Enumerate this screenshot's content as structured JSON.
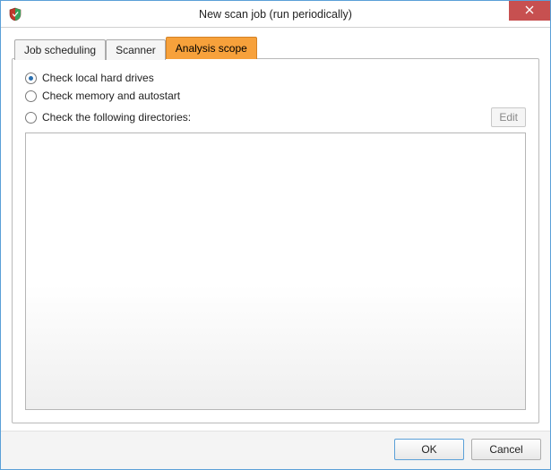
{
  "window": {
    "title": "New scan job (run periodically)"
  },
  "tabs": [
    {
      "label": "Job scheduling",
      "active": false
    },
    {
      "label": "Scanner",
      "active": false
    },
    {
      "label": "Analysis scope",
      "active": true
    }
  ],
  "scope": {
    "options": [
      {
        "label": "Check local hard drives",
        "selected": true
      },
      {
        "label": "Check memory and autostart",
        "selected": false
      },
      {
        "label": "Check the following directories:",
        "selected": false
      }
    ],
    "edit_label": "Edit"
  },
  "buttons": {
    "ok": "OK",
    "cancel": "Cancel"
  }
}
